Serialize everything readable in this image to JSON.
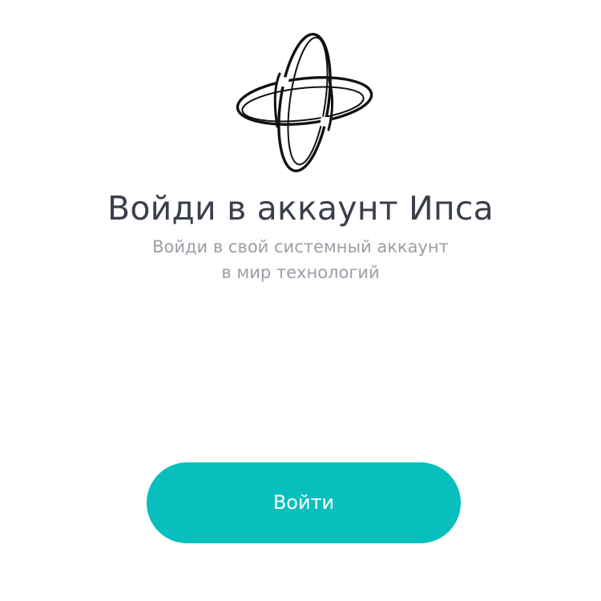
{
  "logo": {
    "icon": "interlocking-rings-logo-icon"
  },
  "header": {
    "title": "Войди в аккаунт Ипса",
    "subtitle_line1": "Войди в свой системный аккаунт",
    "subtitle_line2": "в мир технологий"
  },
  "actions": {
    "login_label": "Войти"
  },
  "colors": {
    "accent": "#08bfbd",
    "title": "#3a3f4b",
    "subtitle": "#9a9ea6",
    "background": "#ffffff"
  }
}
